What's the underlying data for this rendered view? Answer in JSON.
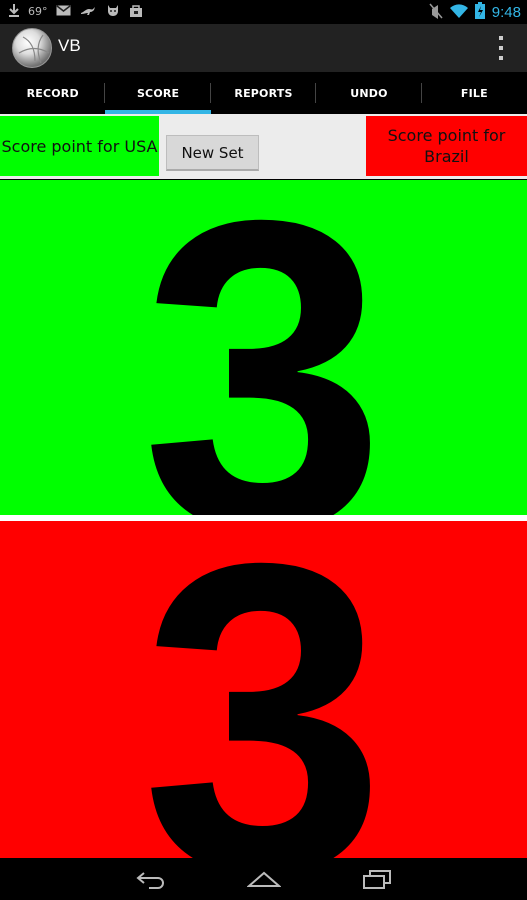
{
  "status_bar": {
    "temperature": "69°",
    "time": "9:48",
    "icons": [
      "download-icon",
      "gmail-icon",
      "kangaroo-icon",
      "cat-icon",
      "bag-icon",
      "mute-icon",
      "wifi-icon",
      "battery-icon"
    ]
  },
  "action_bar": {
    "title": "VB",
    "logo_icon": "volleyball-icon",
    "menu_icon": "overflow-menu-icon"
  },
  "tabs": [
    {
      "label": "RECORD",
      "active": false
    },
    {
      "label": "SCORE",
      "active": true
    },
    {
      "label": "REPORTS",
      "active": false
    },
    {
      "label": "UNDO",
      "active": false
    },
    {
      "label": "FILE",
      "active": false
    }
  ],
  "controls": {
    "usa_button": "Score point for USA",
    "new_set_button": "New Set",
    "brazil_button": "Score point for Brazil"
  },
  "scores": {
    "usa": "3",
    "brazil": "3"
  },
  "colors": {
    "usa": "#00ff00",
    "brazil": "#ff0000",
    "accent": "#33b5e5"
  },
  "nav_bar": {
    "icons": [
      "back-icon",
      "home-icon",
      "recent-apps-icon"
    ]
  }
}
